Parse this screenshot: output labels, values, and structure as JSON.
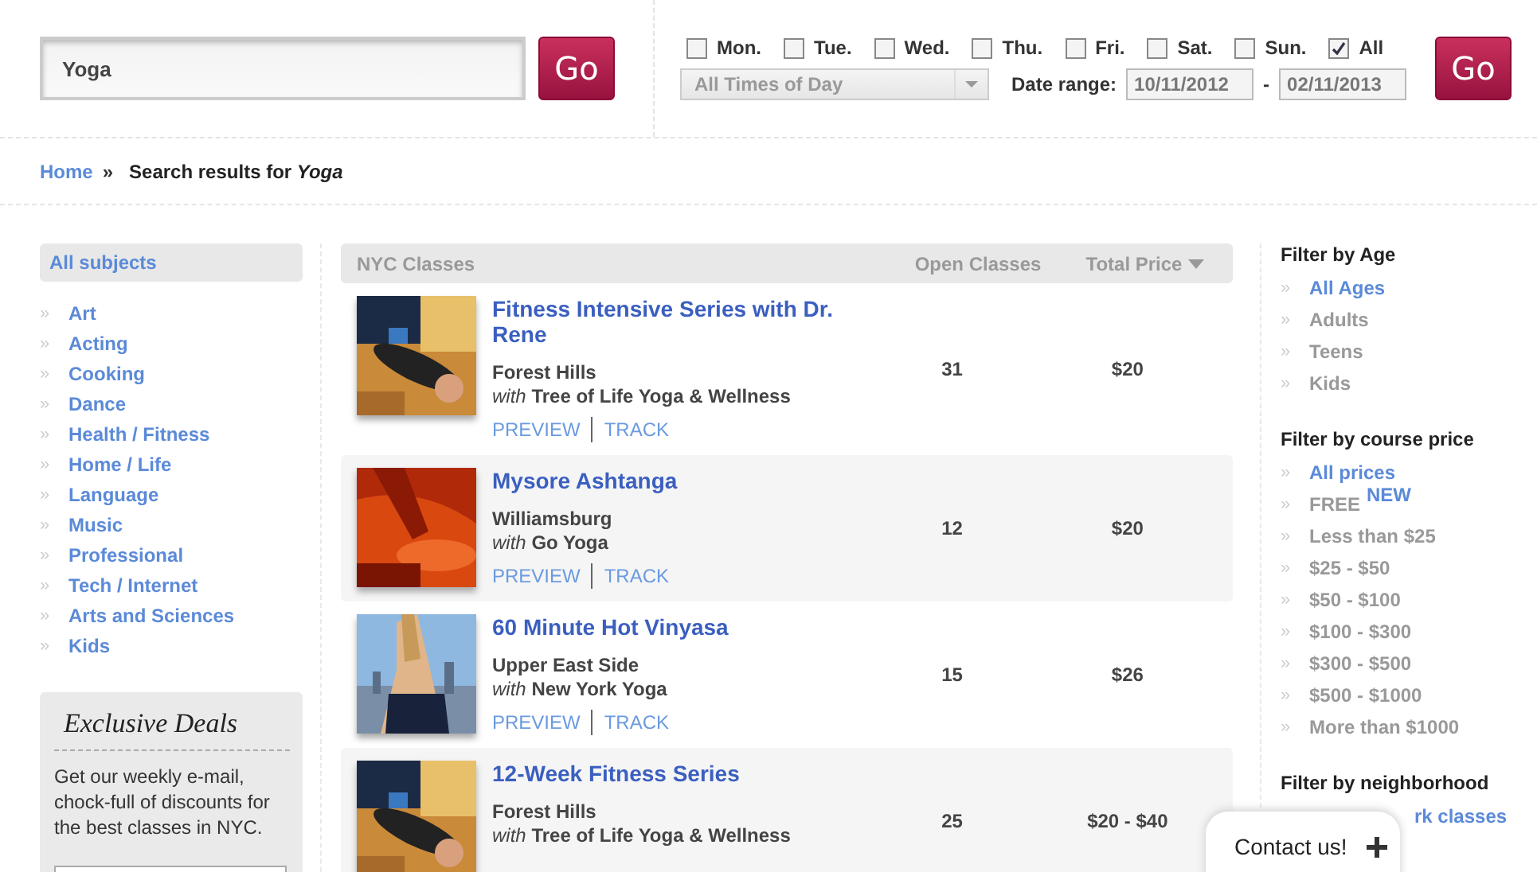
{
  "search": {
    "value": "Yoga",
    "button": "Go"
  },
  "days": [
    {
      "label": "Mon.",
      "checked": false
    },
    {
      "label": "Tue.",
      "checked": false
    },
    {
      "label": "Wed.",
      "checked": false
    },
    {
      "label": "Thu.",
      "checked": false
    },
    {
      "label": "Fri.",
      "checked": false
    },
    {
      "label": "Sat.",
      "checked": false
    },
    {
      "label": "Sun.",
      "checked": false
    },
    {
      "label": "All",
      "checked": true
    }
  ],
  "time_select": "All Times of Day",
  "date_range": {
    "label": "Date range:",
    "from": "10/11/2012",
    "separator": "-",
    "to": "02/11/2013"
  },
  "filter_button": "Go",
  "breadcrumb": {
    "home": "Home",
    "separator": "»",
    "text": "Search results for *Yoga*"
  },
  "bullet": "»",
  "subjects": {
    "heading": "All subjects",
    "items": [
      "Art",
      "Acting",
      "Cooking",
      "Dance",
      "Health / Fitness",
      "Home / Life",
      "Language",
      "Music",
      "Professional",
      "Tech / Internet",
      "Arts and Sciences",
      "Kids"
    ]
  },
  "deals": {
    "title": "Exclusive Deals",
    "text": "Get our weekly e-mail, chock-full of discounts for the best classes in NYC."
  },
  "table": {
    "columns": [
      "NYC Classes",
      "Open Classes",
      "Total Price"
    ],
    "rows": [
      {
        "title": "Fitness Intensive Series with Dr. Rene",
        "location": "Forest Hills",
        "with": "with",
        "provider": "Tree of Life Yoga & Wellness",
        "open": "31",
        "price": "$20",
        "links": [
          "PREVIEW",
          "TRACK"
        ],
        "kind": "picture"
      },
      {
        "title": "Mysore Ashtanga",
        "location": "Williamsburg",
        "with": "with",
        "provider": "Go Yoga",
        "open": "12",
        "price": "$20",
        "links": [
          "PREVIEW",
          "TRACK"
        ],
        "kind": "picture"
      },
      {
        "title": "60 Minute Hot Vinyasa",
        "location": "Upper East Side",
        "with": "with",
        "provider": "New York Yoga",
        "open": "15",
        "price": "$26",
        "links": [
          "PREVIEW",
          "TRACK"
        ],
        "kind": "picture"
      },
      {
        "title": "12-Week Fitness Series",
        "location": "Forest Hills",
        "with": "with",
        "provider": "Tree of Life Yoga & Wellness",
        "open": "25",
        "price": "$20 - $40",
        "kind": "picture"
      }
    ]
  },
  "filters": [
    {
      "heading": "Filter by Age",
      "items": [
        {
          "label": "All Ages",
          "selected": true
        },
        {
          "label": "Adults",
          "selected": false
        },
        {
          "label": "Teens",
          "selected": false
        },
        {
          "label": "Kids",
          "selected": false
        }
      ]
    },
    {
      "heading": "Filter by course price",
      "items": [
        {
          "label": "All prices",
          "selected": true
        },
        {
          "label": "FREE",
          "badge": "NEW",
          "selected": false
        },
        {
          "label": "Less than $25",
          "selected": false
        },
        {
          "label": "$25 - $50",
          "selected": false
        },
        {
          "label": "$50 - $100",
          "selected": false
        },
        {
          "label": "$100 - $300",
          "selected": false
        },
        {
          "label": "$300 - $500",
          "selected": false
        },
        {
          "label": "$500 - $1000",
          "selected": false
        },
        {
          "label": "More than $1000",
          "selected": false
        }
      ]
    },
    {
      "heading": "Filter by neighborhood",
      "items": [
        {
          "label": "rk classes",
          "selected": true
        }
      ]
    }
  ],
  "contact": "Contact us!"
}
